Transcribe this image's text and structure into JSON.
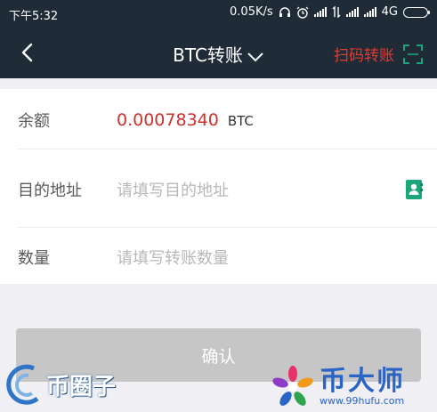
{
  "status_bar": {
    "time": "下午5:32",
    "speed": "0.05K/s",
    "network": "4G"
  },
  "nav": {
    "title": "BTC转账",
    "scan_label": "扫码转账"
  },
  "form": {
    "balance_label": "余额",
    "balance_value": "0.00078340",
    "balance_unit": "BTC",
    "address_label": "目的地址",
    "address_placeholder": "请填写目的地址",
    "amount_label": "数量",
    "amount_placeholder": "请填写转账数量"
  },
  "confirm_label": "确认",
  "watermarks": {
    "left_text": "币圈子",
    "right_brand": "币大师",
    "right_url": "www.99hufu.com"
  },
  "colors": {
    "header_bg": "#1f2b36",
    "accent_red": "#e23b32",
    "balance_red": "#d0312d",
    "contact_green": "#1aa57a",
    "button_disabled": "#c6c6c6"
  }
}
